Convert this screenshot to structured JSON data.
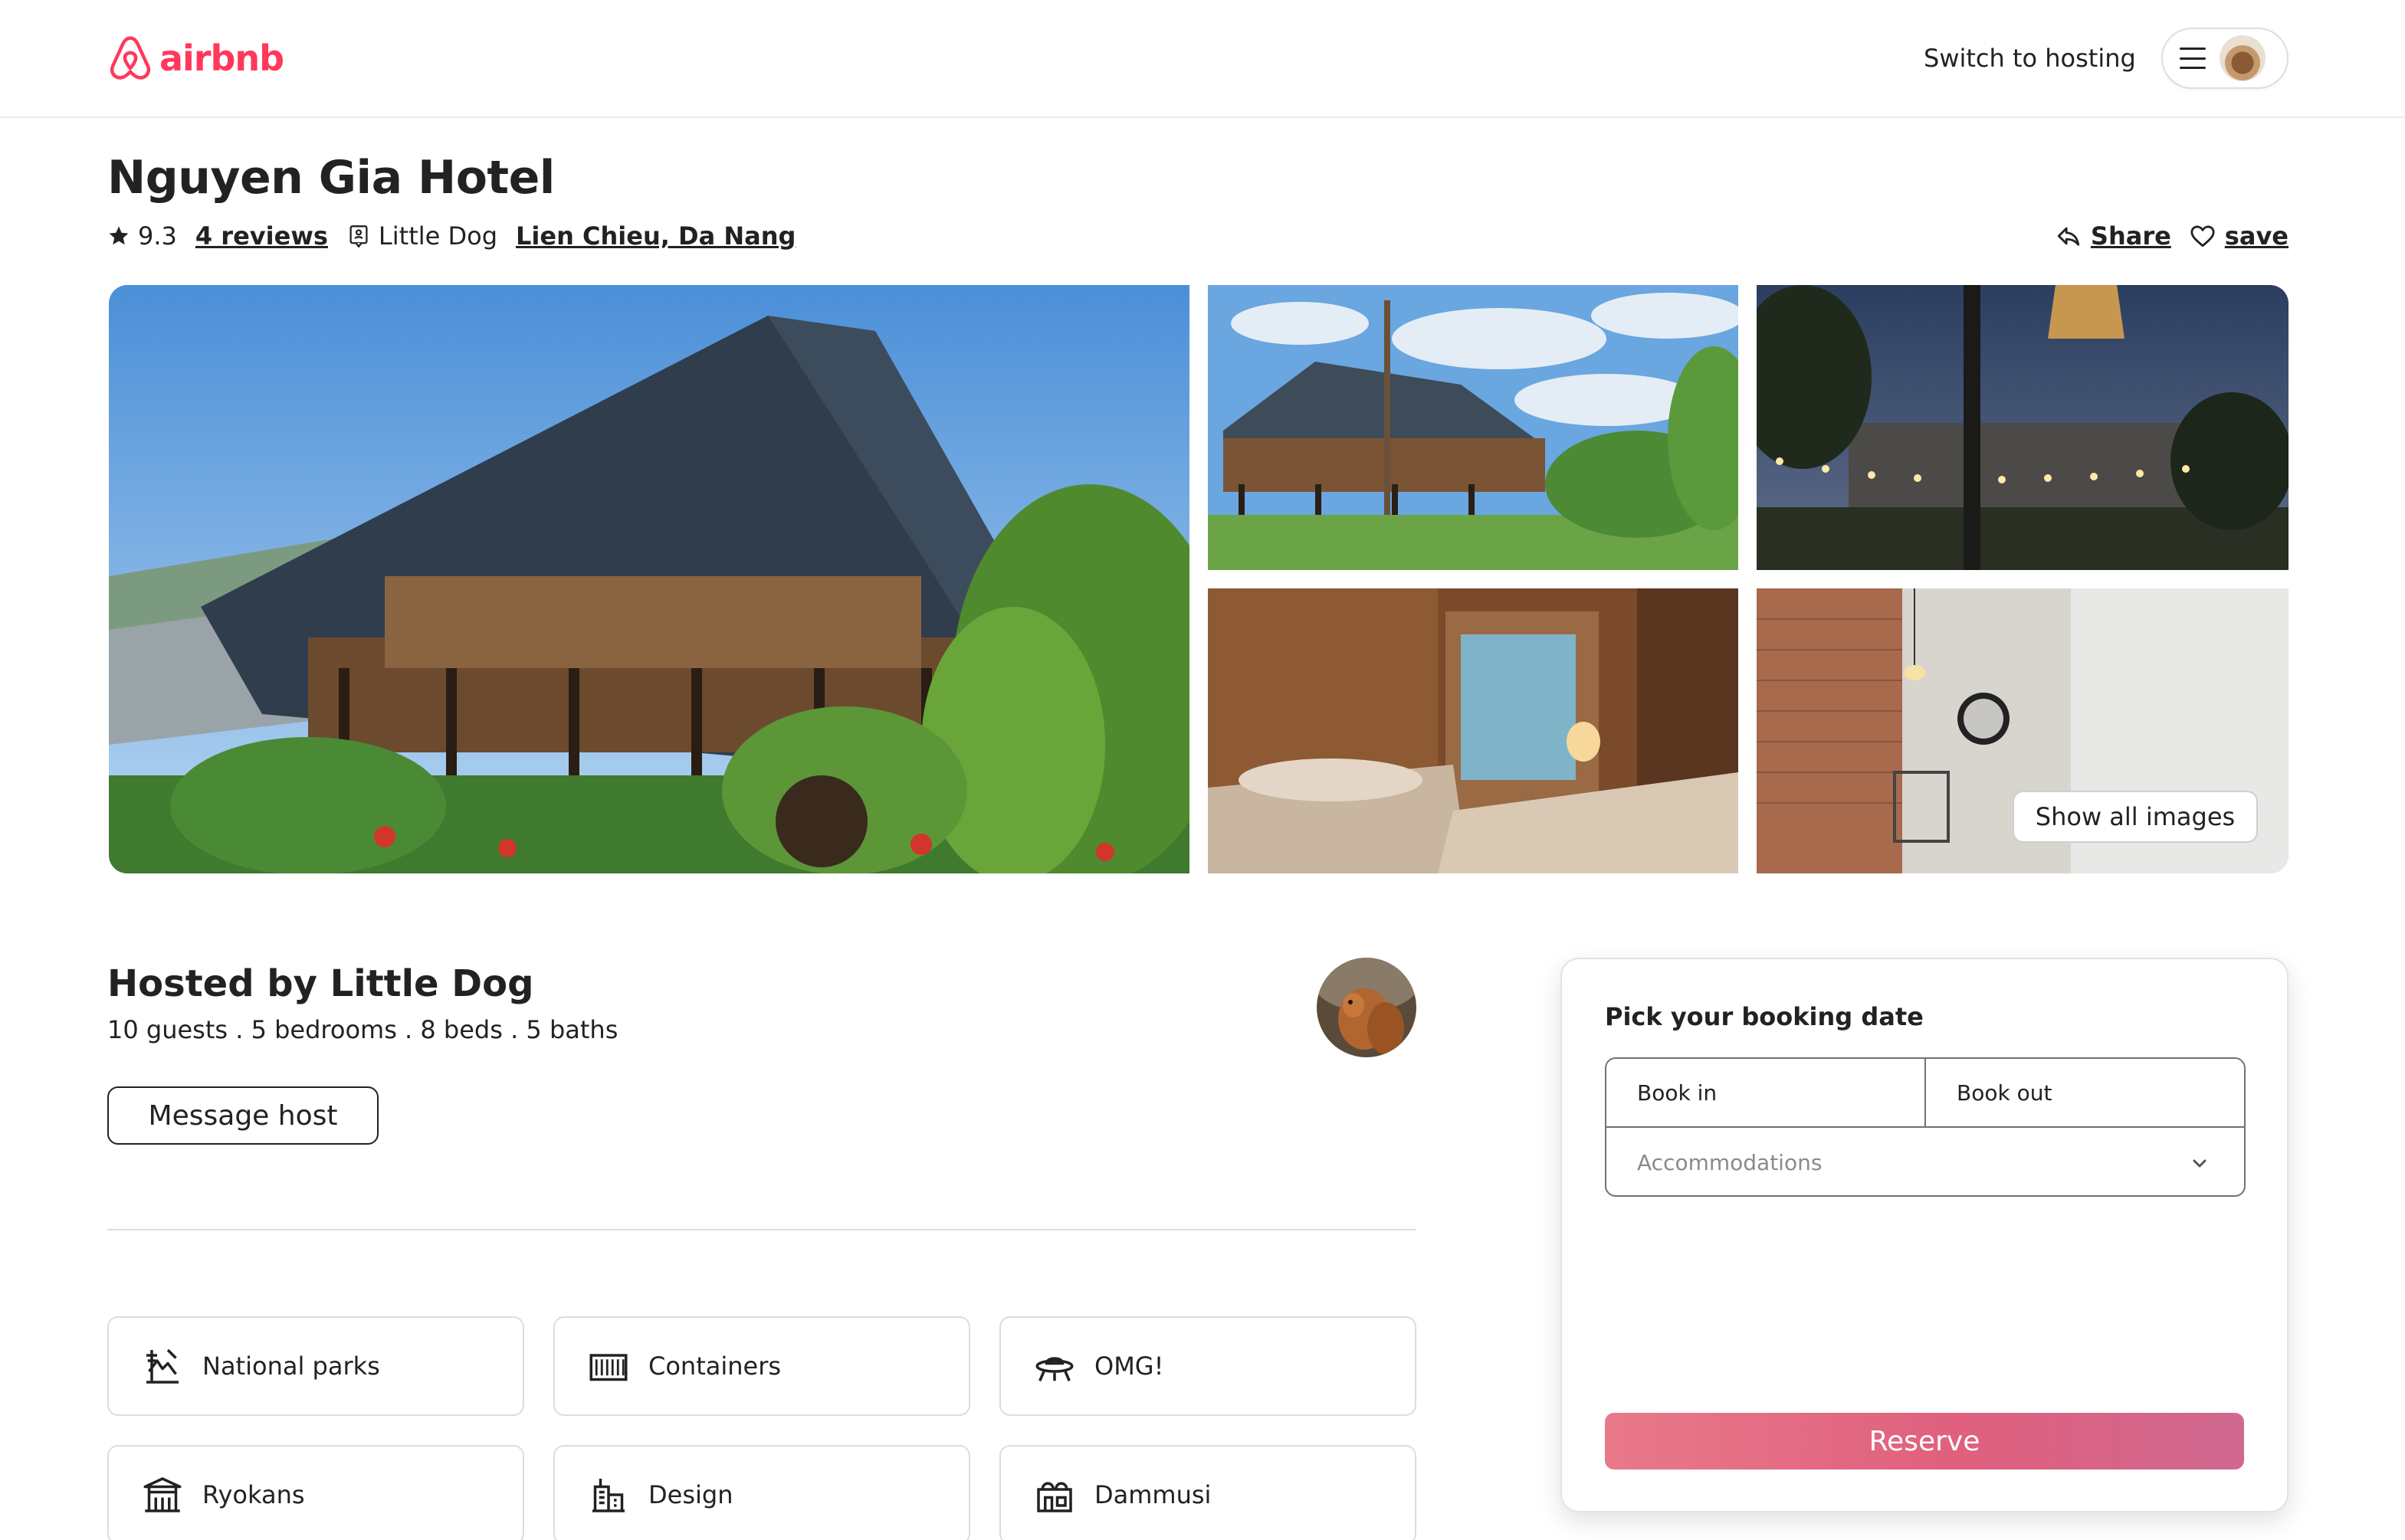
{
  "brand": {
    "name": "airbnb",
    "color": "#ff385c"
  },
  "header": {
    "switch_label": "Switch to hosting",
    "menu_icon": "hamburger-menu-icon",
    "avatar": "user-avatar"
  },
  "listing": {
    "title": "Nguyen Gia Hotel",
    "rating": "9.3",
    "reviews_label": "4 reviews",
    "host_name": "Little Dog",
    "location": "Lien Chieu, Da Nang",
    "share_label": "Share",
    "save_label": "save"
  },
  "gallery": {
    "show_all_label": "Show all images",
    "photos": [
      "stilt-house-exterior",
      "stilt-house-daytime",
      "garden-night-lights",
      "bedroom-twin-beds",
      "bathroom-brick-wall"
    ]
  },
  "host": {
    "title": "Hosted by Little Dog",
    "summary": "10 guests . 5 bedrooms . 8 beds . 5 baths",
    "message_label": "Message host"
  },
  "categories": [
    {
      "label": "National parks",
      "icon": "national-parks-icon"
    },
    {
      "label": "Containers",
      "icon": "containers-icon"
    },
    {
      "label": "OMG!",
      "icon": "ufo-icon"
    },
    {
      "label": "Ryokans",
      "icon": "ryokan-icon"
    },
    {
      "label": "Design",
      "icon": "design-building-icon"
    },
    {
      "label": "Dammusi",
      "icon": "dammusi-icon"
    }
  ],
  "booking": {
    "title": "Pick your booking date",
    "book_in": "Book in",
    "book_out": "Book out",
    "accommodations_placeholder": "Accommodations",
    "reserve_label": "Reserve",
    "reserve_colors": [
      "#e8798a",
      "#d06890"
    ]
  }
}
